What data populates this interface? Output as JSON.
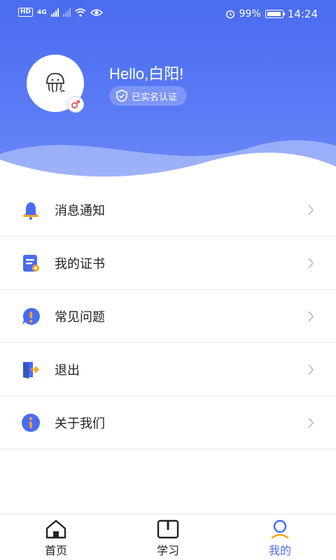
{
  "status_bar": {
    "hd": "HD",
    "net": "4G",
    "battery_pct": "99%",
    "time": "14:24"
  },
  "profile": {
    "greeting": "Hello,白阳!",
    "verified_label": "已实名认证"
  },
  "menu": [
    {
      "label": "消息通知",
      "icon": "bell-icon"
    },
    {
      "label": "我的证书",
      "icon": "certificate-icon"
    },
    {
      "label": "常见问题",
      "icon": "question-bubble-icon"
    },
    {
      "label": "退出",
      "icon": "exit-door-icon"
    },
    {
      "label": "关于我们",
      "icon": "info-icon"
    }
  ],
  "tabs": [
    {
      "label": "首页",
      "icon": "home-icon",
      "active": false
    },
    {
      "label": "学习",
      "icon": "book-icon",
      "active": false
    },
    {
      "label": "我的",
      "icon": "user-icon",
      "active": true
    }
  ],
  "colors": {
    "primary": "#4a6cf0",
    "header_light": "#6f8cf7",
    "icon_orange": "#f5a623",
    "text": "#222222"
  }
}
